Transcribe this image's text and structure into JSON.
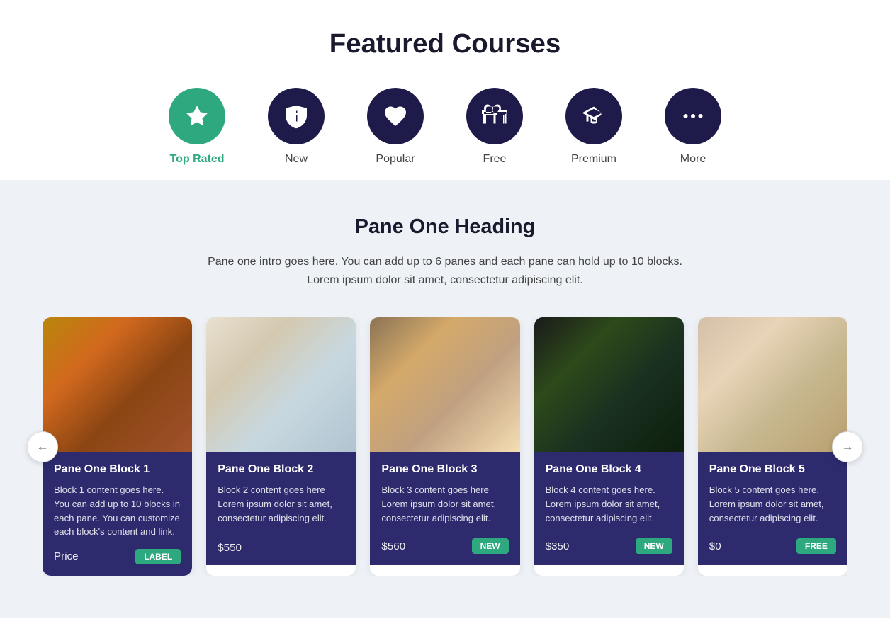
{
  "header": {
    "title": "Featured Courses"
  },
  "tabs": [
    {
      "id": "top-rated",
      "label": "Top Rated",
      "icon": "star",
      "active": true
    },
    {
      "id": "new",
      "label": "New",
      "icon": "megaphone",
      "active": false
    },
    {
      "id": "popular",
      "label": "Popular",
      "icon": "heart",
      "active": false
    },
    {
      "id": "free",
      "label": "Free",
      "icon": "gift",
      "active": false
    },
    {
      "id": "premium",
      "label": "Premium",
      "icon": "graduation",
      "active": false
    },
    {
      "id": "more",
      "label": "More",
      "icon": "dots",
      "active": false
    }
  ],
  "pane": {
    "heading": "Pane One Heading",
    "intro": "Pane one intro goes here. You can add up to 6 panes and each pane can hold up to 10 blocks. Lorem ipsum dolor sit amet, consectetur adipiscing elit."
  },
  "cards": [
    {
      "id": 1,
      "title": "Pane One Block 1",
      "content": "Block 1 content goes here. You can add up to 10 blocks in each pane. You can customize each block's content and link.",
      "price": "Price",
      "badge": "LABEL",
      "badge_type": "label"
    },
    {
      "id": 2,
      "title": "Pane One Block 2",
      "content": "Block 2 content goes here Lorem ipsum dolor sit amet, consectetur adipiscing elit.",
      "price": "$550",
      "badge": null,
      "badge_type": null
    },
    {
      "id": 3,
      "title": "Pane One Block 3",
      "content": "Block 3 content goes here Lorem ipsum dolor sit amet, consectetur adipiscing elit.",
      "price": "$560",
      "badge": "NEW",
      "badge_type": "new"
    },
    {
      "id": 4,
      "title": "Pane One Block 4",
      "content": "Block 4 content goes here. Lorem ipsum dolor sit amet, consectetur adipiscing elit.",
      "price": "$350",
      "badge": "NEW",
      "badge_type": "new"
    },
    {
      "id": 5,
      "title": "Pane One Block 5",
      "content": "Block 5 content goes here. Lorem ipsum dolor sit amet, consectetur adipiscing elit.",
      "price": "$0",
      "badge": "FREE",
      "badge_type": "free"
    }
  ],
  "nav": {
    "prev_label": "←",
    "next_label": "→"
  }
}
